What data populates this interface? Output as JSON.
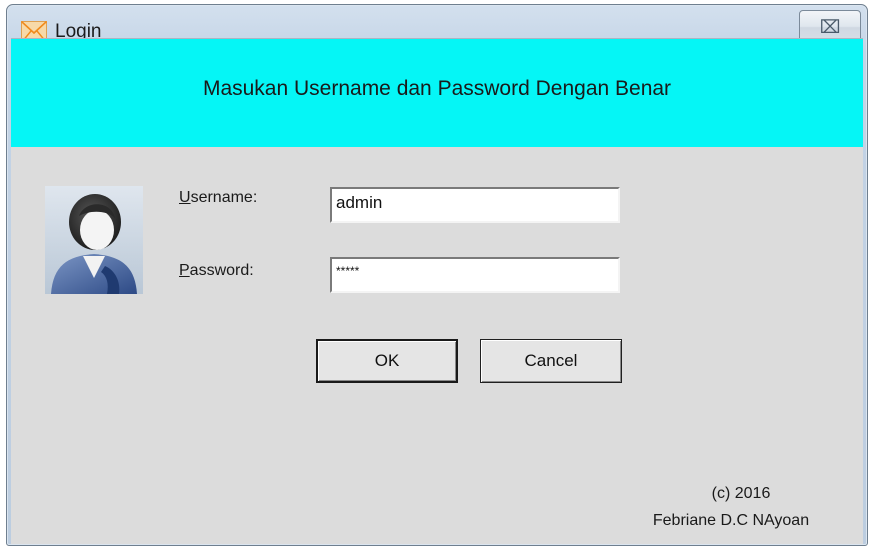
{
  "window": {
    "title": "Login",
    "close_glyph": "⌧",
    "icon": "app-envelope-icon"
  },
  "banner": {
    "text": "Masukan Username dan Password Dengan Benar",
    "color": "#05f6f6"
  },
  "form": {
    "username_label_underlined": "U",
    "username_label_rest": "sername:",
    "username_value": "admin",
    "password_label_underlined": "P",
    "password_label_rest": "assword:",
    "password_value": "*****",
    "avatar_icon": "user-avatar-icon"
  },
  "buttons": {
    "ok_label": "OK",
    "cancel_label": "Cancel"
  },
  "footer": {
    "copyright": "(c) 2016",
    "author": "Febriane D.C NAyoan"
  }
}
